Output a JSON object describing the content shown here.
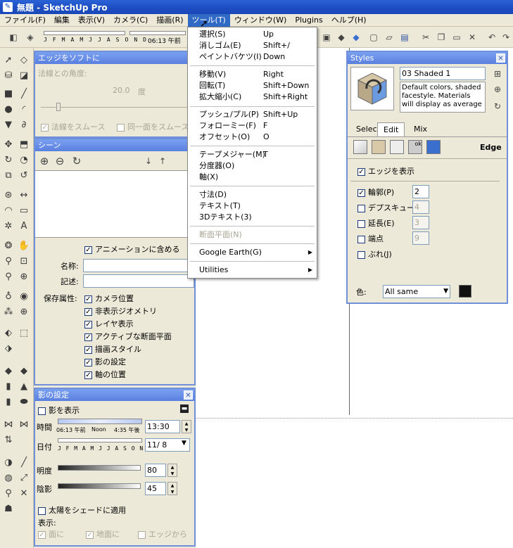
{
  "window": {
    "title": "無題 - SketchUp Pro"
  },
  "menubar": [
    {
      "label": "ファイル(F)"
    },
    {
      "label": "編集"
    },
    {
      "label": "表示(V)"
    },
    {
      "label": "カメラ(C)"
    },
    {
      "label": "描画(R)"
    },
    {
      "label": "ツール(T)"
    },
    {
      "label": "ウィンドウ(W)"
    },
    {
      "label": "Plugins"
    },
    {
      "label": "ヘルプ(H)"
    }
  ],
  "toolbar": {
    "shadow_months": "J F M A M J J A S O N D",
    "shadow_time": "06:13 午前"
  },
  "tools_menu": {
    "groups": [
      [
        {
          "label": "選択(S)",
          "shortcut": "Up"
        },
        {
          "label": "消しゴム(E)",
          "shortcut": "Shift+/"
        },
        {
          "label": "ペイントバケツ(I)",
          "shortcut": "Down"
        }
      ],
      [
        {
          "label": "移動(V)",
          "shortcut": "Right"
        },
        {
          "label": "回転(T)",
          "shortcut": "Shift+Down"
        },
        {
          "label": "拡大縮小(C)",
          "shortcut": "Shift+Right"
        }
      ],
      [
        {
          "label": "プッシュ/プル(P)",
          "shortcut": "Shift+Up"
        },
        {
          "label": "フォローミー(F)",
          "shortcut": "F"
        },
        {
          "label": "オフセット(O)",
          "shortcut": "O"
        }
      ],
      [
        {
          "label": "テープメジャー(M)",
          "shortcut": "T"
        },
        {
          "label": "分度器(O)",
          "shortcut": ""
        },
        {
          "label": "軸(X)",
          "shortcut": ""
        }
      ],
      [
        {
          "label": "寸法(D)",
          "shortcut": ""
        },
        {
          "label": "テキスト(T)",
          "shortcut": ""
        },
        {
          "label": "3Dテキスト(3)",
          "shortcut": ""
        }
      ],
      [
        {
          "label": "断面平面(N)",
          "shortcut": "",
          "disabled": true
        }
      ],
      [
        {
          "label": "Google Earth(G)",
          "submenu": true
        }
      ],
      [
        {
          "label": "Utilities",
          "submenu": true
        }
      ]
    ]
  },
  "soften_panel": {
    "title": "エッジをソフトに",
    "angle_label": "法線との角度:",
    "angle_value": "20.0",
    "angle_unit": "度",
    "smooth_normals": "法線をスムース",
    "soften_coplanar": "同一面をスムース"
  },
  "scenes_panel": {
    "title": "シーン",
    "include_animation": "アニメーションに含める",
    "name_label": "名称:",
    "desc_label": "記述:",
    "properties_label": "保存属性:",
    "properties": [
      "カメラ位置",
      "非表示ジオメトリ",
      "レイヤ表示",
      "アクティブな断面平面",
      "描画スタイル",
      "影の設定",
      "軸の位置"
    ]
  },
  "shadow_panel": {
    "title": "影の設定",
    "show_shadows": "影を表示",
    "time_label": "時間",
    "time_ticks": {
      "start": "06:13 午前",
      "mid": "Noon",
      "end": "4:35 午後"
    },
    "time_value": "13:30",
    "date_label": "日付",
    "date_months": "J F M A M J J A S O N D",
    "date_value": "11/ 8",
    "light_label": "明度",
    "light_value": "80",
    "dark_label": "陰影",
    "dark_value": "45",
    "sun_for_shading": "太陽をシェードに適用",
    "display_label": "表示:",
    "on_faces": "面に",
    "on_ground": "地面に",
    "from_edges": "エッジから"
  },
  "styles_panel": {
    "title": "Styles",
    "style_name": "03 Shaded 1",
    "style_desc": "Default colors, shaded facestyle.  Materials will display as average",
    "tabs": [
      "Select",
      "Edit",
      "Mix"
    ],
    "active_tab": "Edit",
    "section": "Edge",
    "show_edges": "エッジを表示",
    "profiles_label": "輪郭(P)",
    "profiles_value": "2",
    "depth_cue_label": "デプスキュー",
    "depth_cue_value": "4",
    "extension_label": "延長(E)",
    "extension_value": "3",
    "endpoints_label": "端点",
    "endpoints_value": "9",
    "jitter_label": "ぶれ(J)",
    "color_label": "色:",
    "color_value": "All same",
    "swatch_color": "#111111"
  }
}
